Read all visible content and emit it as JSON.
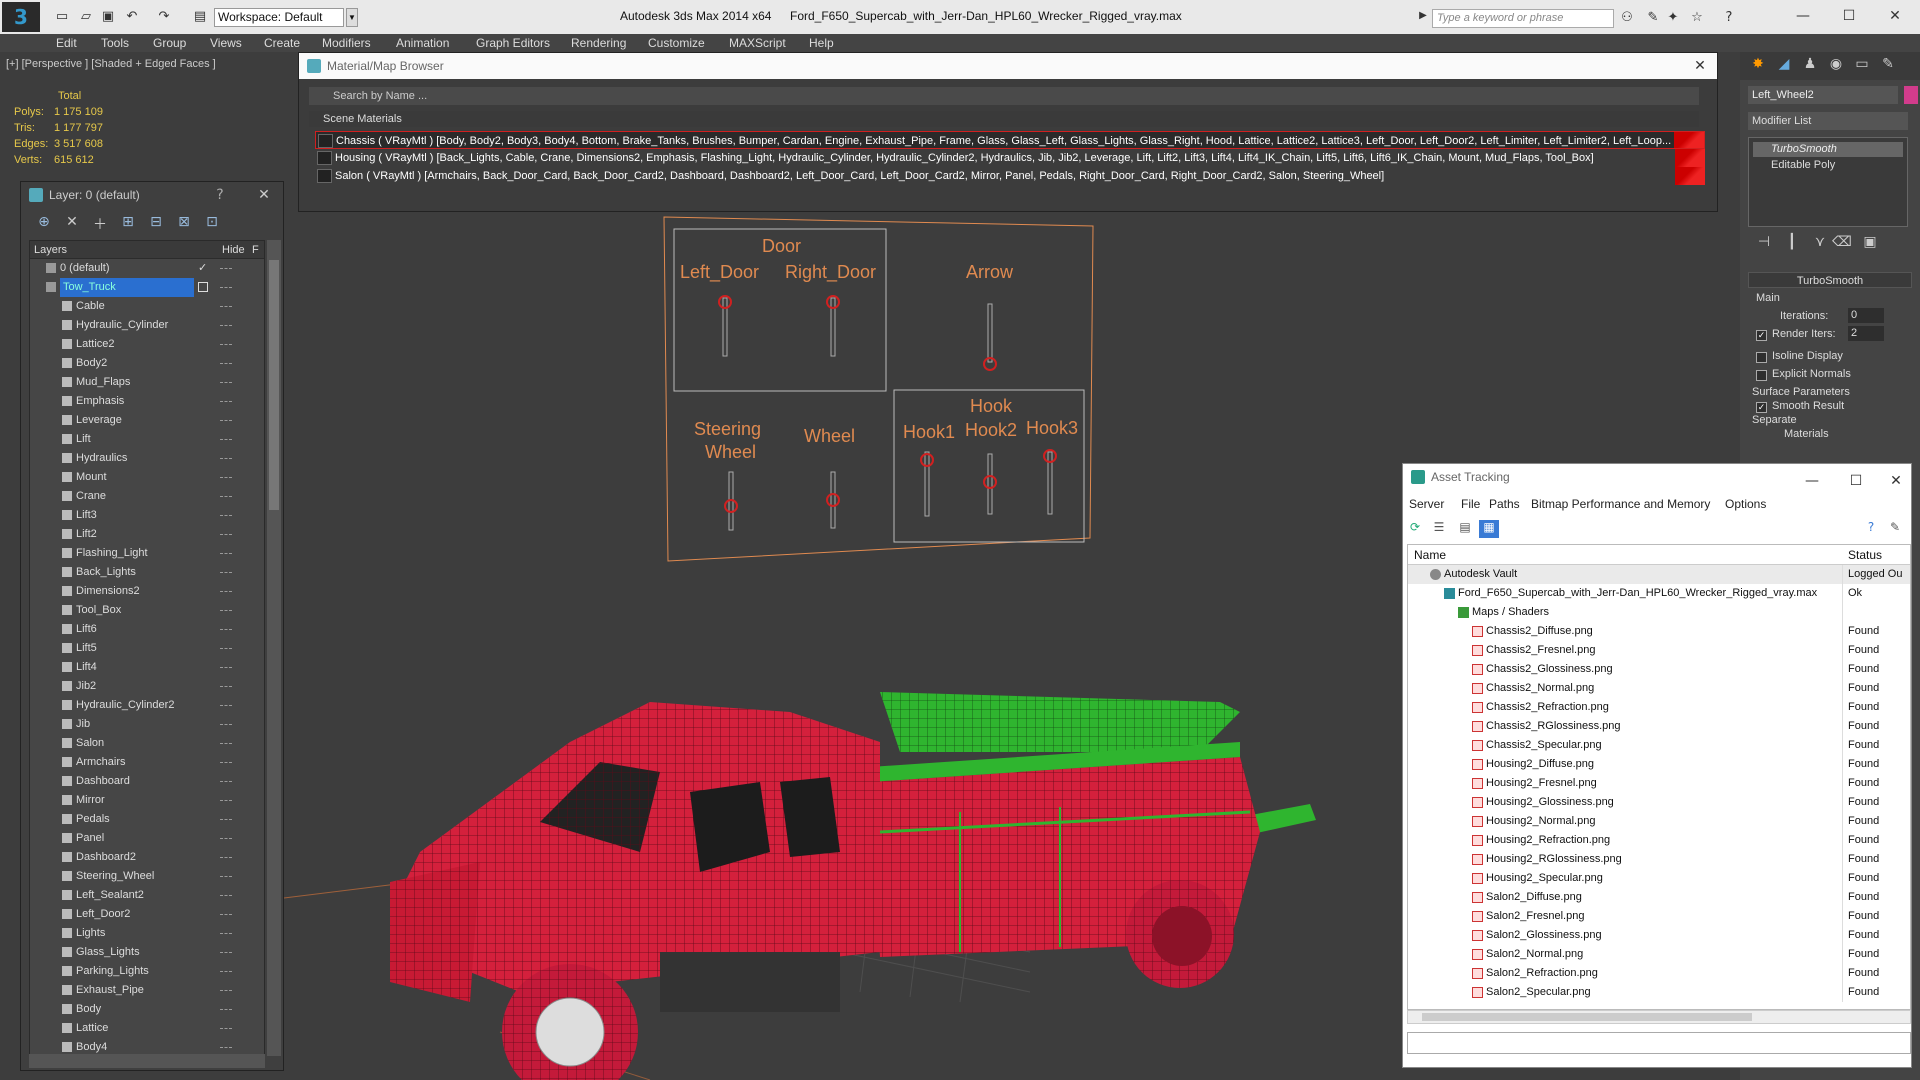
{
  "titlebar": {
    "workspace": "Workspace: Default",
    "app_title": "Autodesk 3ds Max  2014 x64",
    "filename": "Ford_F650_Supercab_with_Jerr-Dan_HPL60_Wrecker_Rigged_vray.max",
    "search_placeholder": "Type a keyword or phrase"
  },
  "menu": [
    "Edit",
    "Tools",
    "Group",
    "Views",
    "Create",
    "Modifiers",
    "Animation",
    "Graph Editors",
    "Rendering",
    "Customize",
    "MAXScript",
    "Help"
  ],
  "viewport": {
    "label": "[+] [Perspective ] [Shaded + Edged Faces ]",
    "stats": {
      "heading": "Total",
      "polys_label": "Polys:",
      "polys": "1 175 109",
      "tris_label": "Tris:",
      "tris": "1 177 797",
      "edges_label": "Edges:",
      "edges": "3 517 608",
      "verts_label": "Verts:",
      "verts": "615 612"
    },
    "rig_labels": {
      "door": "Door",
      "left_door": "Left_Door",
      "right_door": "Right_Door",
      "arrow": "Arrow",
      "steering_1": "Steering",
      "steering_2": "Wheel",
      "wheel": "Wheel",
      "hook": "Hook",
      "hook1": "Hook1",
      "hook2": "Hook2",
      "hook3": "Hook3"
    }
  },
  "material_browser": {
    "title": "Material/Map Browser",
    "search_placeholder": "Search by Name ...",
    "section": "Scene Materials",
    "rows": [
      "Chassis  ( VRayMtl ) [Body, Body2, Body3, Body4, Bottom, Brake_Tanks, Brushes, Bumper, Cardan, Engine, Exhaust_Pipe, Frame, Glass, Glass_Left, Glass_Lights, Glass_Right, Hood, Lattice, Lattice2, Lattice3, Left_Door, Left_Door2, Left_Limiter, Left_Limiter2, Left_Loop...",
      "Housing  ( VRayMtl ) [Back_Lights, Cable, Crane, Dimensions2, Emphasis, Flashing_Light, Hydraulic_Cylinder, Hydraulic_Cylinder2, Hydraulics, Jib, Jib2, Leverage, Lift, Lift2, Lift3, Lift4, Lift4_IK_Chain, Lift5, Lift6, Lift6_IK_Chain, Mount, Mud_Flaps, Tool_Box]",
      "Salon  ( VRayMtl ) [Armchairs, Back_Door_Card, Back_Door_Card2, Dashboard, Dashboard2, Left_Door_Card, Left_Door_Card2, Mirror, Panel, Pedals, Right_Door_Card, Right_Door_Card2, Salon, Steering_Wheel]"
    ]
  },
  "layer_explorer": {
    "title": "Layer: 0 (default)",
    "help": "?",
    "col_layers": "Layers",
    "col_hide": "Hide",
    "col_f": "F",
    "default_layer": "0 (default)",
    "selected_layer": "Tow_Truck",
    "objects": [
      "Cable",
      "Hydraulic_Cylinder",
      "Lattice2",
      "Body2",
      "Mud_Flaps",
      "Emphasis",
      "Leverage",
      "Lift",
      "Hydraulics",
      "Mount",
      "Crane",
      "Lift3",
      "Lift2",
      "Flashing_Light",
      "Back_Lights",
      "Dimensions2",
      "Tool_Box",
      "Lift6",
      "Lift5",
      "Lift4",
      "Jib2",
      "Hydraulic_Cylinder2",
      "Jib",
      "Salon",
      "Armchairs",
      "Dashboard",
      "Mirror",
      "Pedals",
      "Panel",
      "Dashboard2",
      "Steering_Wheel",
      "Left_Sealant2",
      "Left_Door2",
      "Lights",
      "Glass_Lights",
      "Parking_Lights",
      "Exhaust_Pipe",
      "Body",
      "Lattice",
      "Body4"
    ]
  },
  "command_panel": {
    "object_name": "Left_Wheel2",
    "object_color": "#d23c8c",
    "modifier_list": "Modifier List",
    "stack": [
      "TurboSmooth",
      "Editable Poly"
    ],
    "rollout": "TurboSmooth",
    "main_label": "Main",
    "iterations_label": "Iterations:",
    "iterations": "0",
    "render_iters_label": "Render Iters:",
    "render_iters": "2",
    "isoline": "Isoline Display",
    "explicit_normals": "Explicit Normals",
    "surface_params": "Surface Parameters",
    "smooth_result": "Smooth Result",
    "separate": "Separate",
    "materials": "Materials"
  },
  "asset_tracking": {
    "title": "Asset Tracking",
    "menu": [
      "Server",
      "File",
      "Paths",
      "Bitmap Performance and Memory",
      "Options"
    ],
    "col_name": "Name",
    "col_status": "Status",
    "vault": "Autodesk Vault",
    "vault_status": "Logged Ou",
    "file": "Ford_F650_Supercab_with_Jerr-Dan_HPL60_Wrecker_Rigged_vray.max",
    "file_status": "Ok",
    "maps_folder": "Maps / Shaders",
    "maps": [
      {
        "name": "Chassis2_Diffuse.png",
        "status": "Found"
      },
      {
        "name": "Chassis2_Fresnel.png",
        "status": "Found"
      },
      {
        "name": "Chassis2_Glossiness.png",
        "status": "Found"
      },
      {
        "name": "Chassis2_Normal.png",
        "status": "Found"
      },
      {
        "name": "Chassis2_Refraction.png",
        "status": "Found"
      },
      {
        "name": "Chassis2_RGlossiness.png",
        "status": "Found"
      },
      {
        "name": "Chassis2_Specular.png",
        "status": "Found"
      },
      {
        "name": "Housing2_Diffuse.png",
        "status": "Found"
      },
      {
        "name": "Housing2_Fresnel.png",
        "status": "Found"
      },
      {
        "name": "Housing2_Glossiness.png",
        "status": "Found"
      },
      {
        "name": "Housing2_Normal.png",
        "status": "Found"
      },
      {
        "name": "Housing2_Refraction.png",
        "status": "Found"
      },
      {
        "name": "Housing2_RGlossiness.png",
        "status": "Found"
      },
      {
        "name": "Housing2_Specular.png",
        "status": "Found"
      },
      {
        "name": "Salon2_Diffuse.png",
        "status": "Found"
      },
      {
        "name": "Salon2_Fresnel.png",
        "status": "Found"
      },
      {
        "name": "Salon2_Glossiness.png",
        "status": "Found"
      },
      {
        "name": "Salon2_Normal.png",
        "status": "Found"
      },
      {
        "name": "Salon2_Refraction.png",
        "status": "Found"
      },
      {
        "name": "Salon2_Specular.png",
        "status": "Found"
      }
    ]
  },
  "colors": {
    "truck_body": "#d4203c",
    "wire_green": "#2fb52f",
    "rig_orange": "#e08a50",
    "selection_blue": "#2a6fd0"
  }
}
